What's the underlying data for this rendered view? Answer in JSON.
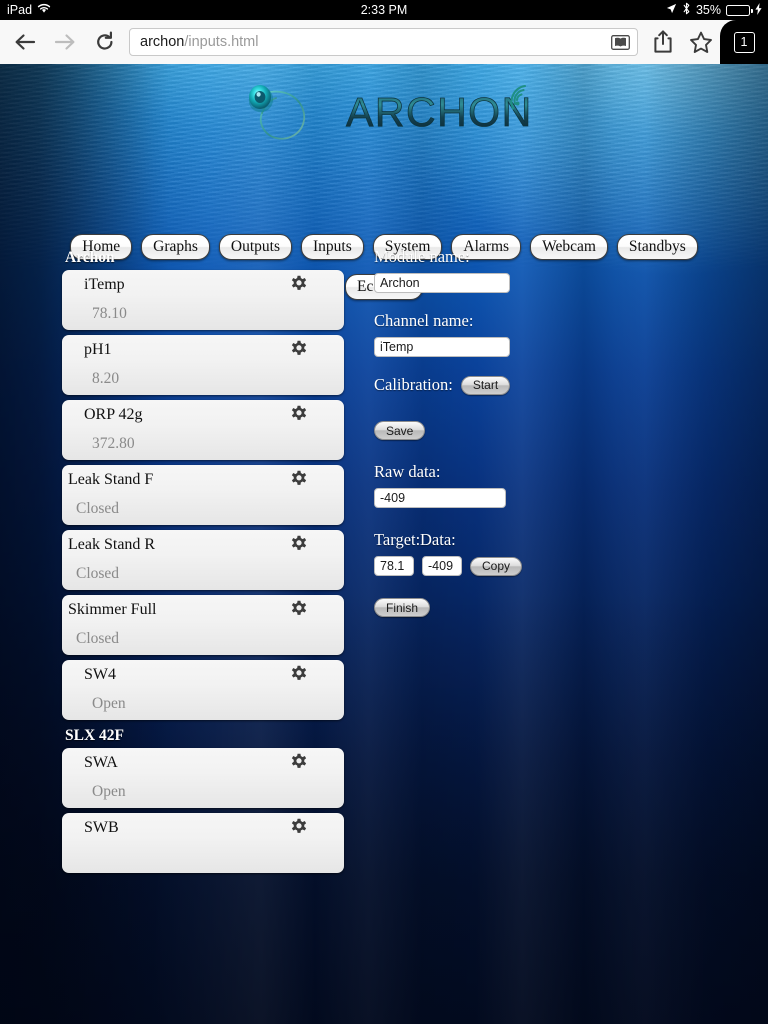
{
  "status_bar": {
    "device": "iPad",
    "wifi_icon": "wifi-icon",
    "time": "2:33 PM",
    "location_icon": "location-arrow-icon",
    "bluetooth_icon": "bluetooth-icon",
    "battery_percent": "35%",
    "battery_level": 35,
    "charging": true
  },
  "browser": {
    "back_icon": "back-arrow-icon",
    "forward_icon": "forward-arrow-icon",
    "reload_icon": "reload-icon",
    "url_host": "archon",
    "url_path": "/inputs.html",
    "reader_icon": "reader-view-icon",
    "share_icon": "share-icon",
    "bookmark_icon": "bookmark-star-icon",
    "tab_count": "1"
  },
  "header": {
    "brand": "ARCHON",
    "logo_icon": "archon-swirl-logo-icon",
    "signal_icon": "signal-waves-icon"
  },
  "nav": {
    "row1": [
      {
        "label": "Home"
      },
      {
        "label": "Graphs"
      },
      {
        "label": "Outputs"
      },
      {
        "label": "Inputs"
      },
      {
        "label": "System"
      },
      {
        "label": "Alarms"
      },
      {
        "label": "Webcam"
      },
      {
        "label": "Standbys"
      }
    ],
    "row2": [
      {
        "label": "EcoTech"
      }
    ]
  },
  "channels": {
    "groups": [
      {
        "name": "Archon",
        "items": [
          {
            "title": "iTemp",
            "value": "78.10",
            "indent": true,
            "gear_icon": "gear-icon"
          },
          {
            "title": "pH1",
            "value": "8.20",
            "indent": true,
            "gear_icon": "gear-icon"
          },
          {
            "title": "ORP 42g",
            "value": "372.80",
            "indent": true,
            "gear_icon": "gear-icon"
          },
          {
            "title": "Leak Stand F",
            "value": "Closed",
            "indent": false,
            "gear_icon": "gear-icon"
          },
          {
            "title": "Leak Stand R",
            "value": "Closed",
            "indent": false,
            "gear_icon": "gear-icon"
          },
          {
            "title": "Skimmer Full",
            "value": "Closed",
            "indent": false,
            "gear_icon": "gear-icon"
          },
          {
            "title": "SW4",
            "value": "Open",
            "indent": true,
            "gear_icon": "gear-icon"
          }
        ]
      },
      {
        "name": "SLX 42F",
        "items": [
          {
            "title": "SWA",
            "value": "Open",
            "indent": true,
            "gear_icon": "gear-icon"
          },
          {
            "title": "SWB",
            "value": "",
            "indent": true,
            "gear_icon": "gear-icon"
          }
        ]
      }
    ]
  },
  "form": {
    "module_label": "Module name:",
    "module_value": "Archon",
    "channel_label": "Channel name:",
    "channel_value": "iTemp",
    "calibration_label": "Calibration:",
    "start_button": "Start",
    "save_button": "Save",
    "raw_data_label": "Raw data:",
    "raw_data_value": "-409",
    "target_label": "Target:",
    "data_label": "Data:",
    "target_value": "78.1",
    "data_value": "-409",
    "copy_button": "Copy",
    "finish_button": "Finish"
  }
}
